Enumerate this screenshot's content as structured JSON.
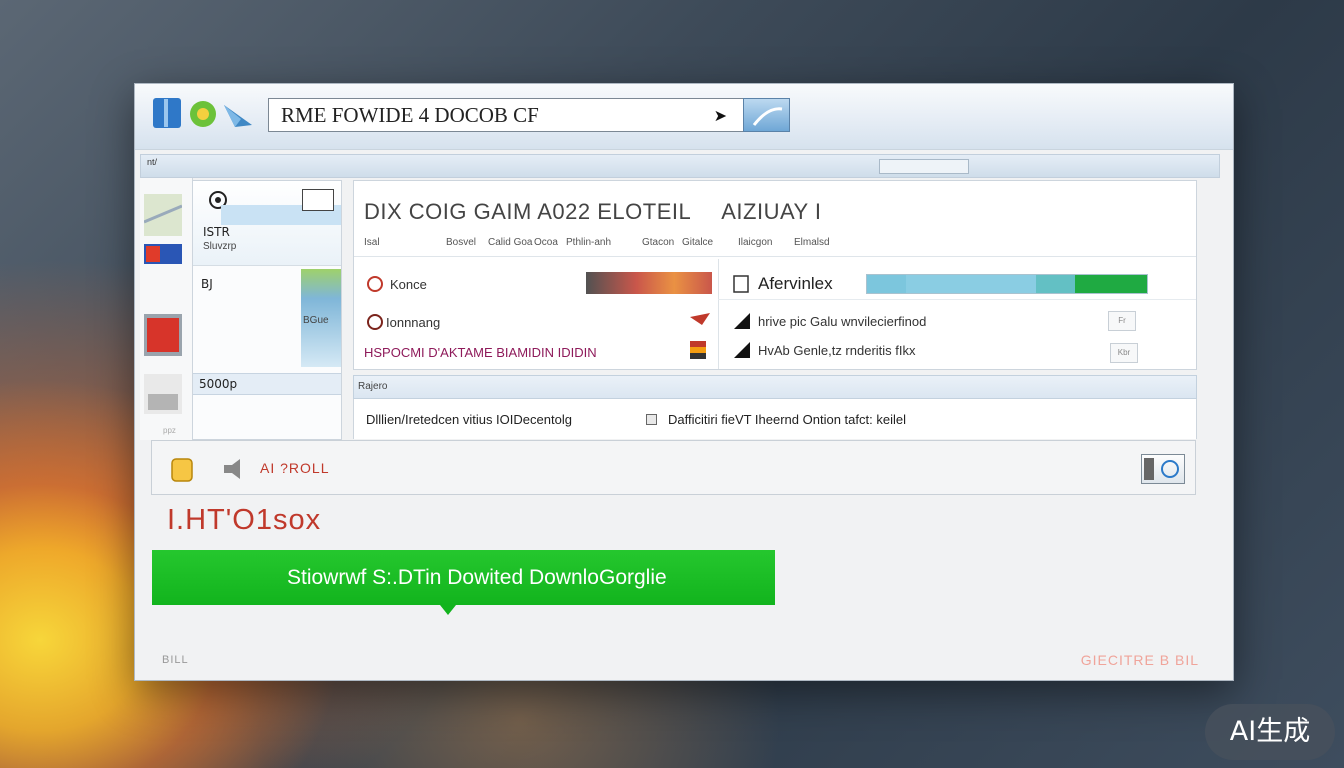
{
  "address_bar": {
    "value": "RME FOWIDE 4 DOCOB CF"
  },
  "strip": {
    "label": "nt/"
  },
  "subpanel": {
    "item1_title": "ISTR",
    "item1_sub": "Sluvzrp",
    "item2_label": "BJ",
    "item3_label": "BGue",
    "item4_label": "5000p",
    "footer_label": "ppz"
  },
  "main": {
    "title": "DIX COIG GAIM A022 ELOTEIL",
    "title2": "AIZIUAY I",
    "columns": [
      "Isal",
      "Bosvel",
      "Calid Goa",
      "Ocoa",
      "Pthlin-anh",
      "Gtacon",
      "Gitalce",
      "Ilaicgon",
      "Elmalsd"
    ],
    "rows": [
      {
        "label": "Konce",
        "right_label": "Afervinlex"
      },
      {
        "label": "Ionnnang",
        "right_label": "hrive pic Galu wnvilecierfinod",
        "btn": "Fr"
      },
      {
        "label": "HSPOCMI D'AKTAME BIAMIDIN IDIDIN",
        "right_label": "HvAb Genle,tz rnderitis fIkx",
        "btn": "Kbr"
      }
    ],
    "progress": {
      "segments": [
        0.16,
        0.54,
        0.16,
        0.3
      ],
      "colors": [
        "#7cc6dd",
        "#8acde3",
        "#63c0c4",
        "#1faa42"
      ]
    }
  },
  "infobar": {
    "label": "Rajero"
  },
  "options": {
    "opt1": "Dlllien/Iretedcen vitius IOIDecentolg",
    "opt2": "Dafficitiri fieVT Iheernd Ontion tafct: keilel"
  },
  "status": {
    "text": "AI ?ROLL"
  },
  "heading": "I.HT'O1sox",
  "download_button": {
    "label": "Stiowrwf S:.DTin Dowited DownloGorglie"
  },
  "footer": {
    "left": "BILL",
    "right": "GIECITRE B BIL"
  },
  "badge": "AI生成"
}
